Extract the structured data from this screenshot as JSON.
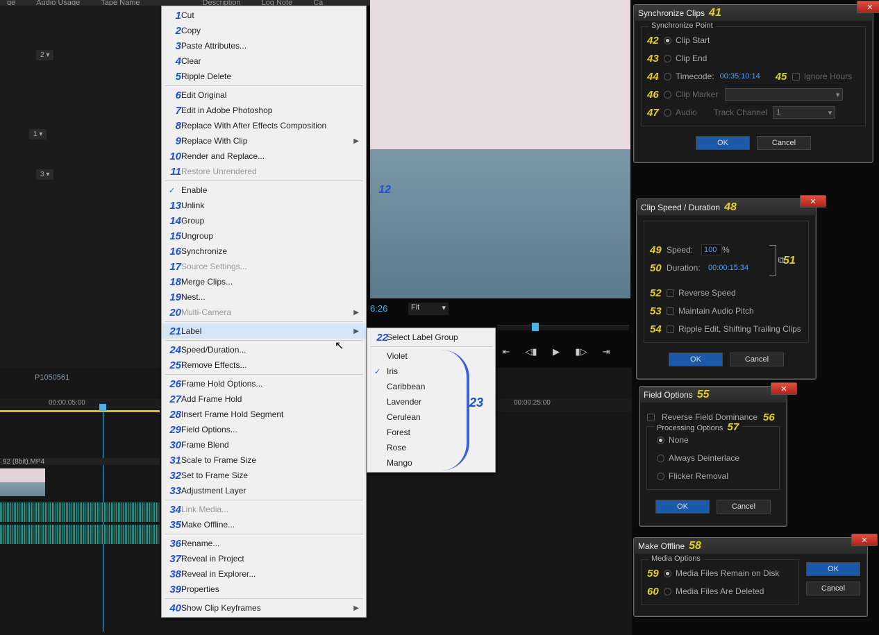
{
  "header_cols": [
    "ge",
    "Audio Usage",
    "Tape Name",
    "Description",
    "Log Note",
    "Ca"
  ],
  "seq_markers": [
    "2",
    "1",
    "3"
  ],
  "preview": {
    "time": "6:26",
    "fit": "Fit"
  },
  "timeline": {
    "clip_name": "P1050561",
    "t5": "00:00:05:00",
    "t25": "00:00:25:00",
    "track_label": "92 (8bit).MP4"
  },
  "ctx": [
    {
      "n": "1",
      "t": "Cut"
    },
    {
      "n": "2",
      "t": "Copy"
    },
    {
      "n": "3",
      "t": "Paste Attributes..."
    },
    {
      "n": "4",
      "t": "Clear"
    },
    {
      "n": "5",
      "t": "Ripple Delete"
    },
    {
      "sep": 1
    },
    {
      "n": "6",
      "t": "Edit Original"
    },
    {
      "n": "7",
      "t": "Edit in Adobe Photoshop"
    },
    {
      "n": "8",
      "t": "Replace With After Effects Composition"
    },
    {
      "n": "9",
      "t": "Replace With Clip",
      "sub": 1
    },
    {
      "n": "10",
      "t": "Render and Replace..."
    },
    {
      "n": "11",
      "t": "Restore Unrendered",
      "dis": 1
    },
    {
      "sep": 1
    },
    {
      "n": "",
      "nr": "12",
      "t": "Enable",
      "chk": 1
    },
    {
      "n": "13",
      "t": "Unlink"
    },
    {
      "n": "14",
      "t": "Group"
    },
    {
      "n": "15",
      "t": "Ungroup"
    },
    {
      "n": "16",
      "t": "Synchronize"
    },
    {
      "n": "17",
      "t": "Source Settings...",
      "dis": 1
    },
    {
      "n": "18",
      "t": "Merge Clips..."
    },
    {
      "n": "19",
      "t": "Nest..."
    },
    {
      "n": "20",
      "t": "Multi-Camera",
      "dis": 1,
      "sub": 1
    },
    {
      "sep": 1
    },
    {
      "n": "21",
      "t": "Label",
      "hl": 1,
      "sub": 1
    },
    {
      "sep": 1
    },
    {
      "n": "24",
      "t": "Speed/Duration..."
    },
    {
      "n": "25",
      "t": "Remove Effects..."
    },
    {
      "sep": 1
    },
    {
      "n": "26",
      "t": "Frame Hold Options..."
    },
    {
      "n": "27",
      "t": "Add Frame Hold"
    },
    {
      "n": "28",
      "t": "Insert Frame Hold Segment"
    },
    {
      "n": "29",
      "t": "Field Options..."
    },
    {
      "n": "30",
      "t": "Frame Blend"
    },
    {
      "n": "31",
      "t": "Scale to Frame Size"
    },
    {
      "n": "32",
      "t": "Set to Frame Size"
    },
    {
      "n": "33",
      "t": "Adjustment Layer"
    },
    {
      "sep": 1
    },
    {
      "n": "34",
      "t": "Link Media...",
      "dis": 1
    },
    {
      "n": "35",
      "t": "Make Offline..."
    },
    {
      "sep": 1
    },
    {
      "n": "36",
      "t": "Rename..."
    },
    {
      "n": "37",
      "t": "Reveal in Project"
    },
    {
      "n": "38",
      "t": "Reveal in Explorer..."
    },
    {
      "n": "39",
      "t": "Properties"
    },
    {
      "sep": 1
    },
    {
      "n": "40",
      "t": "Show Clip Keyframes",
      "sub": 1
    }
  ],
  "submenu": {
    "header_n": "22",
    "header": "Select Label Group",
    "items": [
      "Violet",
      "Iris",
      "Caribbean",
      "Lavender",
      "Cerulean",
      "Forest",
      "Rose",
      "Mango"
    ],
    "checked": 1,
    "group_n": "23"
  },
  "sync": {
    "title": "Synchronize Clips",
    "title_n": "41",
    "legend": "Synchronize Point",
    "r1_n": "42",
    "r1": "Clip Start",
    "r2_n": "43",
    "r2": "Clip End",
    "r3_n": "44",
    "r3": "Timecode:",
    "r3_val": "00:35:10:14",
    "r4_n": "45",
    "r4": "Ignore Hours",
    "r5_n": "46",
    "r5": "Clip Marker",
    "r6_n": "47",
    "r6": "Audio",
    "r6b": "Track Channel",
    "r6c": "1",
    "ok": "OK",
    "cancel": "Cancel"
  },
  "speed": {
    "title": "Clip Speed / Duration",
    "title_n": "48",
    "r1_n": "49",
    "r1": "Speed:",
    "r1_val": "100",
    "r1_unit": "%",
    "r2_n": "50",
    "r2": "Duration:",
    "r2_val": "00:00:15:34",
    "link_n": "51",
    "c1_n": "52",
    "c1": "Reverse Speed",
    "c2_n": "53",
    "c2": "Maintain Audio Pitch",
    "c3_n": "54",
    "c3": "Ripple Edit, Shifting Trailing Clips",
    "ok": "OK",
    "cancel": "Cancel"
  },
  "field": {
    "title": "Field Options",
    "title_n": "55",
    "c1_n": "56",
    "c1": "Reverse Field Dominance",
    "legend": "Processing Options",
    "leg_n": "57",
    "r1": "None",
    "r2": "Always Deinterlace",
    "r3": "Flicker Removal",
    "ok": "OK",
    "cancel": "Cancel"
  },
  "offline": {
    "title": "Make Offline",
    "title_n": "58",
    "legend": "Media Options",
    "r1_n": "59",
    "r1": "Media Files Remain on Disk",
    "r2_n": "60",
    "r2": "Media Files Are Deleted",
    "ok": "OK",
    "cancel": "Cancel"
  }
}
